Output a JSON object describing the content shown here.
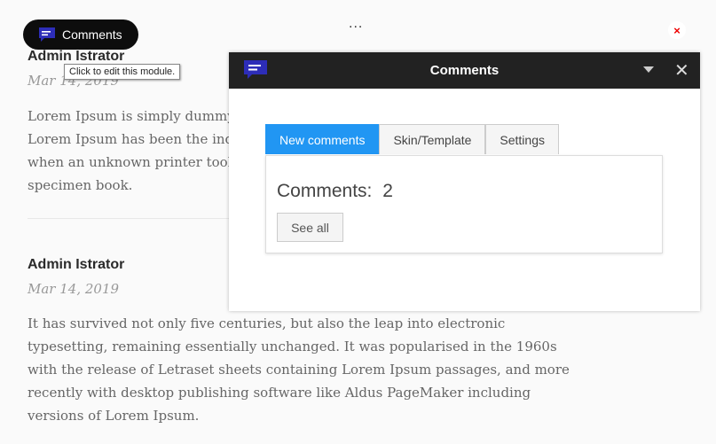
{
  "module_pill": {
    "label": "Comments"
  },
  "toolbar": {
    "more_label": "...",
    "close_label": "×"
  },
  "tooltip": {
    "text": "Click to edit this module."
  },
  "posts": [
    {
      "author": "Admin Istrator",
      "date": "Mar 14, 2019",
      "lines": [
        "Lorem Ipsum is simply dummy",
        "Lorem Ipsum has been the indu",
        "when an unknown printer took",
        "specimen book."
      ]
    },
    {
      "author": "Admin Istrator",
      "date": "Mar 14, 2019",
      "lines": [
        "It has survived not only five centuries, but also the leap into electronic",
        "typesetting, remaining essentially unchanged. It was popularised in the 1960s",
        "with the release of Letraset sheets containing Lorem Ipsum passages, and more",
        "recently with desktop publishing software like Aldus PageMaker including",
        "versions of Lorem Ipsum."
      ]
    }
  ],
  "dialog": {
    "title": "Comments",
    "close_label": "✕",
    "tabs": [
      {
        "label": "New comments",
        "active": true
      },
      {
        "label": "Skin/Template",
        "active": false
      },
      {
        "label": "Settings",
        "active": false
      }
    ],
    "comments_label": "Comments:",
    "comments_count": "2",
    "see_all_label": "See all"
  },
  "colors": {
    "accent": "#2196f3",
    "icon": "#2d2db8",
    "header": "#222222",
    "close": "#e00000"
  }
}
